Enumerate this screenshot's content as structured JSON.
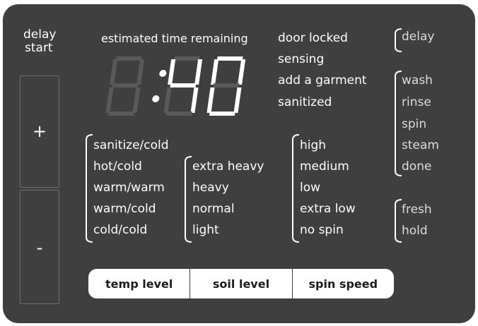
{
  "delay_start": {
    "line1": "delay",
    "line2": "start"
  },
  "buttons": {
    "plus": "+",
    "minus": "-"
  },
  "timer": {
    "label": "estimated time remaining",
    "display": "40"
  },
  "status": [
    "door locked",
    "sensing",
    "add a garment",
    "sanitized"
  ],
  "cycle_status": {
    "top": [
      "delay"
    ],
    "middle": [
      "wash",
      "rinse",
      "spin",
      "steam",
      "done"
    ],
    "bottom": [
      "fresh",
      "hold"
    ]
  },
  "temp_options": [
    "sanitize/cold",
    "hot/cold",
    "warm/warm",
    "warm/cold",
    "cold/cold"
  ],
  "soil_options": [
    "extra heavy",
    "heavy",
    "normal",
    "light"
  ],
  "spin_options": [
    "high",
    "medium",
    "low",
    "extra low",
    "no spin"
  ],
  "tabs": {
    "temp": "temp level",
    "soil": "soil level",
    "spin": "spin speed"
  }
}
